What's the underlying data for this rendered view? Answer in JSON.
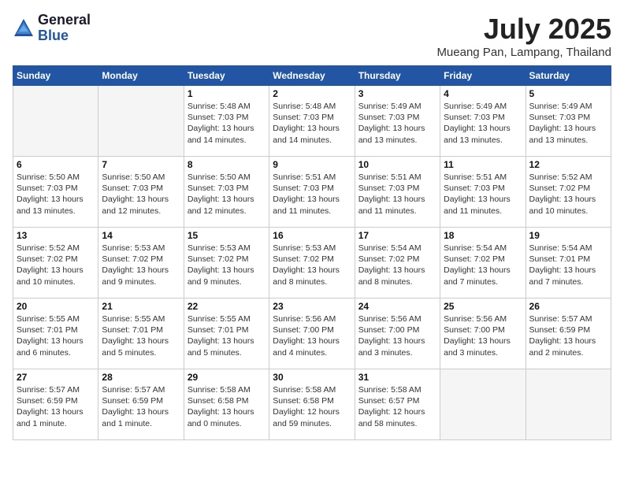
{
  "header": {
    "logo_general": "General",
    "logo_blue": "Blue",
    "month_year": "July 2025",
    "location": "Mueang Pan, Lampang, Thailand"
  },
  "days_of_week": [
    "Sunday",
    "Monday",
    "Tuesday",
    "Wednesday",
    "Thursday",
    "Friday",
    "Saturday"
  ],
  "weeks": [
    [
      {
        "day": "",
        "empty": true
      },
      {
        "day": "",
        "empty": true
      },
      {
        "day": "1",
        "line1": "Sunrise: 5:48 AM",
        "line2": "Sunset: 7:03 PM",
        "line3": "Daylight: 13 hours",
        "line4": "and 14 minutes."
      },
      {
        "day": "2",
        "line1": "Sunrise: 5:48 AM",
        "line2": "Sunset: 7:03 PM",
        "line3": "Daylight: 13 hours",
        "line4": "and 14 minutes."
      },
      {
        "day": "3",
        "line1": "Sunrise: 5:49 AM",
        "line2": "Sunset: 7:03 PM",
        "line3": "Daylight: 13 hours",
        "line4": "and 13 minutes."
      },
      {
        "day": "4",
        "line1": "Sunrise: 5:49 AM",
        "line2": "Sunset: 7:03 PM",
        "line3": "Daylight: 13 hours",
        "line4": "and 13 minutes."
      },
      {
        "day": "5",
        "line1": "Sunrise: 5:49 AM",
        "line2": "Sunset: 7:03 PM",
        "line3": "Daylight: 13 hours",
        "line4": "and 13 minutes."
      }
    ],
    [
      {
        "day": "6",
        "line1": "Sunrise: 5:50 AM",
        "line2": "Sunset: 7:03 PM",
        "line3": "Daylight: 13 hours",
        "line4": "and 13 minutes."
      },
      {
        "day": "7",
        "line1": "Sunrise: 5:50 AM",
        "line2": "Sunset: 7:03 PM",
        "line3": "Daylight: 13 hours",
        "line4": "and 12 minutes."
      },
      {
        "day": "8",
        "line1": "Sunrise: 5:50 AM",
        "line2": "Sunset: 7:03 PM",
        "line3": "Daylight: 13 hours",
        "line4": "and 12 minutes."
      },
      {
        "day": "9",
        "line1": "Sunrise: 5:51 AM",
        "line2": "Sunset: 7:03 PM",
        "line3": "Daylight: 13 hours",
        "line4": "and 11 minutes."
      },
      {
        "day": "10",
        "line1": "Sunrise: 5:51 AM",
        "line2": "Sunset: 7:03 PM",
        "line3": "Daylight: 13 hours",
        "line4": "and 11 minutes."
      },
      {
        "day": "11",
        "line1": "Sunrise: 5:51 AM",
        "line2": "Sunset: 7:03 PM",
        "line3": "Daylight: 13 hours",
        "line4": "and 11 minutes."
      },
      {
        "day": "12",
        "line1": "Sunrise: 5:52 AM",
        "line2": "Sunset: 7:02 PM",
        "line3": "Daylight: 13 hours",
        "line4": "and 10 minutes."
      }
    ],
    [
      {
        "day": "13",
        "line1": "Sunrise: 5:52 AM",
        "line2": "Sunset: 7:02 PM",
        "line3": "Daylight: 13 hours",
        "line4": "and 10 minutes."
      },
      {
        "day": "14",
        "line1": "Sunrise: 5:53 AM",
        "line2": "Sunset: 7:02 PM",
        "line3": "Daylight: 13 hours",
        "line4": "and 9 minutes."
      },
      {
        "day": "15",
        "line1": "Sunrise: 5:53 AM",
        "line2": "Sunset: 7:02 PM",
        "line3": "Daylight: 13 hours",
        "line4": "and 9 minutes."
      },
      {
        "day": "16",
        "line1": "Sunrise: 5:53 AM",
        "line2": "Sunset: 7:02 PM",
        "line3": "Daylight: 13 hours",
        "line4": "and 8 minutes."
      },
      {
        "day": "17",
        "line1": "Sunrise: 5:54 AM",
        "line2": "Sunset: 7:02 PM",
        "line3": "Daylight: 13 hours",
        "line4": "and 8 minutes."
      },
      {
        "day": "18",
        "line1": "Sunrise: 5:54 AM",
        "line2": "Sunset: 7:02 PM",
        "line3": "Daylight: 13 hours",
        "line4": "and 7 minutes."
      },
      {
        "day": "19",
        "line1": "Sunrise: 5:54 AM",
        "line2": "Sunset: 7:01 PM",
        "line3": "Daylight: 13 hours",
        "line4": "and 7 minutes."
      }
    ],
    [
      {
        "day": "20",
        "line1": "Sunrise: 5:55 AM",
        "line2": "Sunset: 7:01 PM",
        "line3": "Daylight: 13 hours",
        "line4": "and 6 minutes."
      },
      {
        "day": "21",
        "line1": "Sunrise: 5:55 AM",
        "line2": "Sunset: 7:01 PM",
        "line3": "Daylight: 13 hours",
        "line4": "and 5 minutes."
      },
      {
        "day": "22",
        "line1": "Sunrise: 5:55 AM",
        "line2": "Sunset: 7:01 PM",
        "line3": "Daylight: 13 hours",
        "line4": "and 5 minutes."
      },
      {
        "day": "23",
        "line1": "Sunrise: 5:56 AM",
        "line2": "Sunset: 7:00 PM",
        "line3": "Daylight: 13 hours",
        "line4": "and 4 minutes."
      },
      {
        "day": "24",
        "line1": "Sunrise: 5:56 AM",
        "line2": "Sunset: 7:00 PM",
        "line3": "Daylight: 13 hours",
        "line4": "and 3 minutes."
      },
      {
        "day": "25",
        "line1": "Sunrise: 5:56 AM",
        "line2": "Sunset: 7:00 PM",
        "line3": "Daylight: 13 hours",
        "line4": "and 3 minutes."
      },
      {
        "day": "26",
        "line1": "Sunrise: 5:57 AM",
        "line2": "Sunset: 6:59 PM",
        "line3": "Daylight: 13 hours",
        "line4": "and 2 minutes."
      }
    ],
    [
      {
        "day": "27",
        "line1": "Sunrise: 5:57 AM",
        "line2": "Sunset: 6:59 PM",
        "line3": "Daylight: 13 hours",
        "line4": "and 1 minute."
      },
      {
        "day": "28",
        "line1": "Sunrise: 5:57 AM",
        "line2": "Sunset: 6:59 PM",
        "line3": "Daylight: 13 hours",
        "line4": "and 1 minute."
      },
      {
        "day": "29",
        "line1": "Sunrise: 5:58 AM",
        "line2": "Sunset: 6:58 PM",
        "line3": "Daylight: 13 hours",
        "line4": "and 0 minutes."
      },
      {
        "day": "30",
        "line1": "Sunrise: 5:58 AM",
        "line2": "Sunset: 6:58 PM",
        "line3": "Daylight: 12 hours",
        "line4": "and 59 minutes."
      },
      {
        "day": "31",
        "line1": "Sunrise: 5:58 AM",
        "line2": "Sunset: 6:57 PM",
        "line3": "Daylight: 12 hours",
        "line4": "and 58 minutes."
      },
      {
        "day": "",
        "empty": true
      },
      {
        "day": "",
        "empty": true
      }
    ]
  ]
}
